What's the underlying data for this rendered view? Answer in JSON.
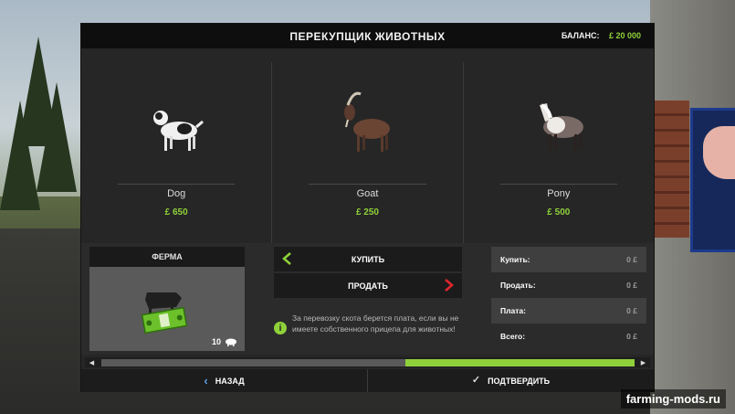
{
  "header": {
    "title": "ПЕРЕКУПЩИК ЖИВОТНЫХ",
    "balance_label": "БАЛАНС:",
    "balance_value": "£ 20 000"
  },
  "animals": [
    {
      "name": "Dog",
      "price": "£ 650",
      "icon": "dog-icon"
    },
    {
      "name": "Goat",
      "price": "£ 250",
      "icon": "goat-icon"
    },
    {
      "name": "Pony",
      "price": "£ 500",
      "icon": "pony-icon"
    }
  ],
  "farm": {
    "title": "ФЕРМА",
    "count": "10",
    "icon": "cow-money-icon"
  },
  "actions": {
    "buy_label": "КУПИТЬ",
    "sell_label": "ПРОДАТЬ",
    "info_text": "За перевозку скота берется плата, если вы не имеете собственного прицепа для животных!"
  },
  "summary": [
    {
      "label": "Купить:",
      "value": "0 £"
    },
    {
      "label": "Продать:",
      "value": "0 £"
    },
    {
      "label": "Плата:",
      "value": "0 £"
    },
    {
      "label": "Всего:",
      "value": "0 £"
    }
  ],
  "scroll": {
    "position": 0.43
  },
  "footer": {
    "back_label": "НАЗАД",
    "confirm_label": "ПОДТВЕРДИТЬ"
  },
  "watermark": "farming-mods.ru",
  "colors": {
    "accent": "#8fd13a",
    "panel": "#262626",
    "arrow_red": "#e0262d"
  }
}
